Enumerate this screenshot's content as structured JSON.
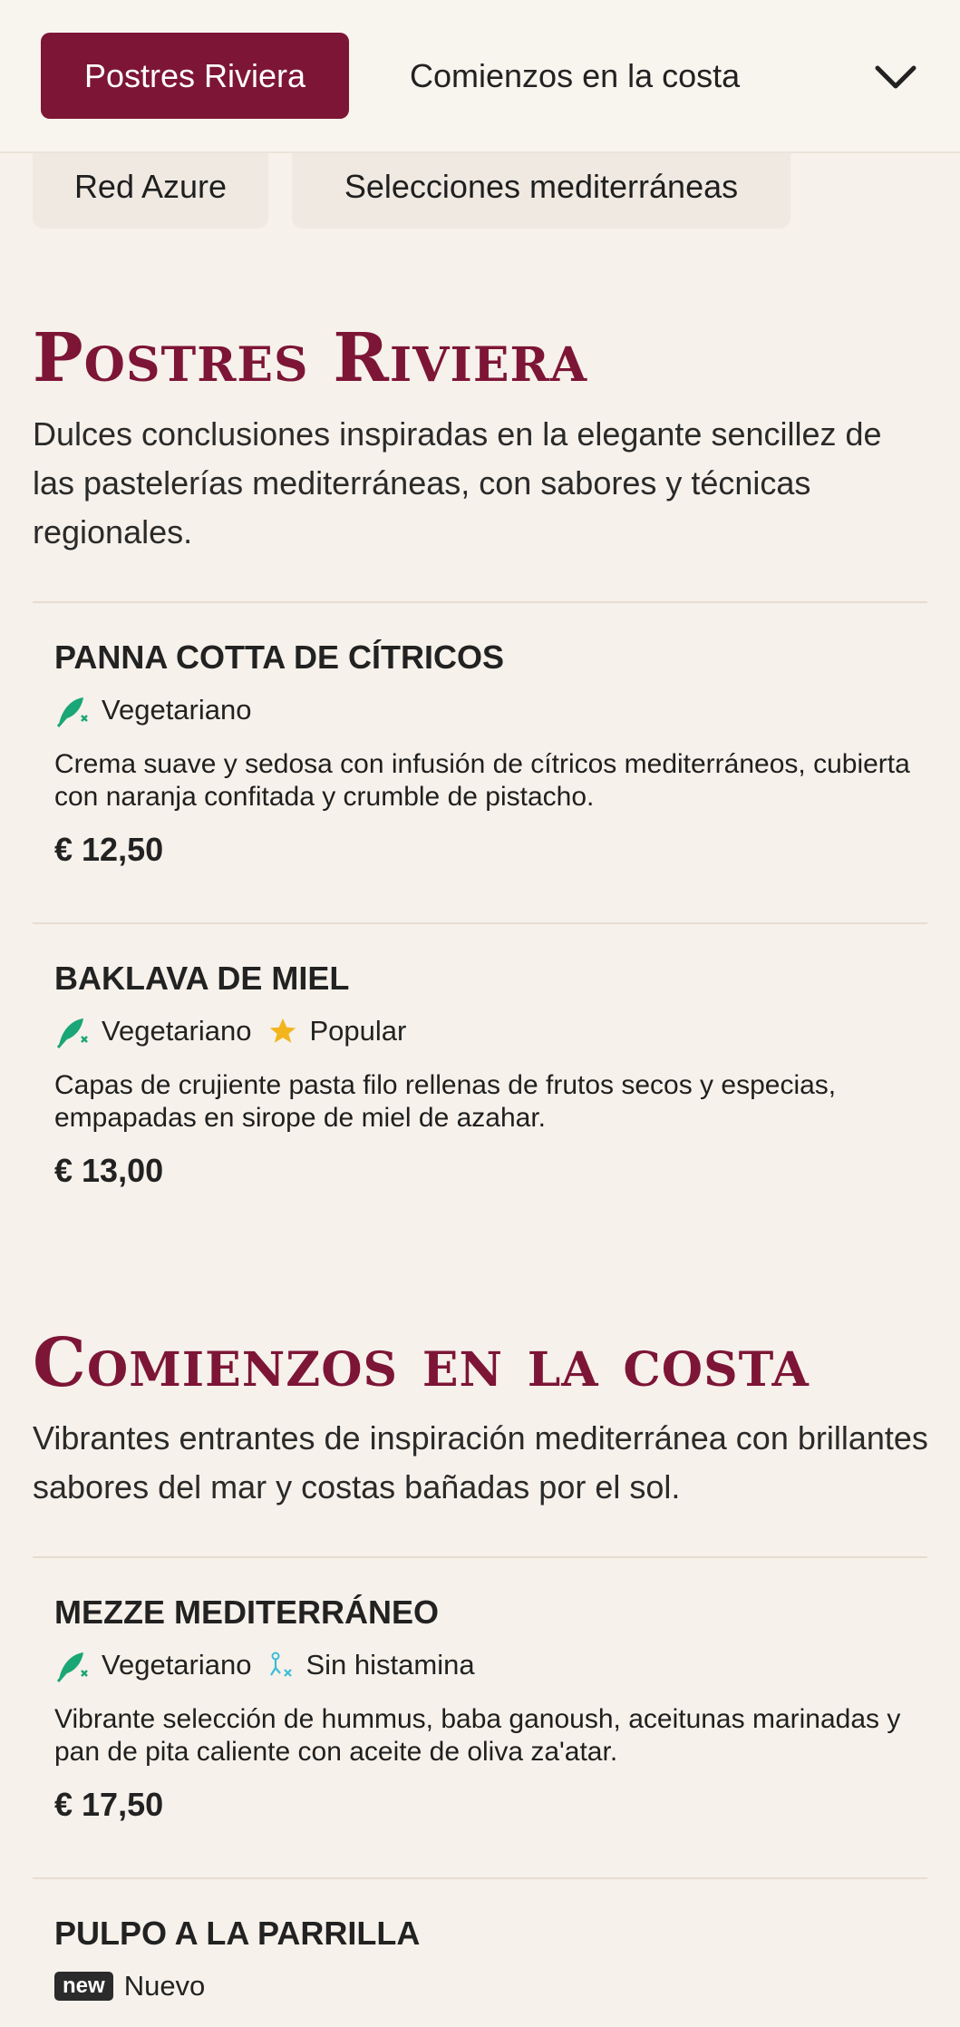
{
  "nav": {
    "active_tab": "Postres Riviera",
    "next_tab": "Comienzos en la costa",
    "chips": [
      "Red Azure",
      "Selecciones mediterráneas"
    ]
  },
  "colors": {
    "accent": "#7d1537",
    "vegetarian": "#1aa676",
    "histamine": "#3bbcd9",
    "star": "#f2b51d",
    "background": "#f6f1ea"
  },
  "icons": {
    "dropdown": "chevron-down-icon",
    "vegetarian": "leaf-icon",
    "popular": "star-icon",
    "histamine_free": "histamine-free-icon"
  },
  "sections": [
    {
      "title": "Postres Riviera",
      "description": "Dulces conclusiones inspiradas en la elegante sencillez de las pastelerías mediterráneas, con sabores y técnicas regionales.",
      "items": [
        {
          "name": "PANNA COTTA DE CÍTRICOS",
          "tags": [
            "Vegetariano"
          ],
          "description": "Crema suave y sedosa con infusión de cítricos mediterráneos, cubierta con naranja confitada y crumble de pistacho.",
          "price": "€ 12,50"
        },
        {
          "name": "BAKLAVA DE MIEL",
          "tags": [
            "Vegetariano",
            "Popular"
          ],
          "description": "Capas de crujiente pasta filo rellenas de frutos secos y especias, empapadas en sirope de miel de azahar.",
          "price": "€ 13,00"
        }
      ]
    },
    {
      "title": "Comienzos en la costa",
      "description": "Vibrantes entrantes de inspiración mediterránea con brillantes sabores del mar y costas bañadas por el sol.",
      "items": [
        {
          "name": "MEZZE MEDITERRÁNEO",
          "tags": [
            "Vegetariano",
            "Sin histamina"
          ],
          "description": "Vibrante selección de hummus, baba ganoush, aceitunas marinadas y pan de pita caliente con aceite de oliva za'atar.",
          "price": "€ 17,50"
        },
        {
          "name": "PULPO A LA PARRILLA",
          "badge": "new",
          "tags": [
            "Nuevo"
          ]
        }
      ]
    }
  ]
}
